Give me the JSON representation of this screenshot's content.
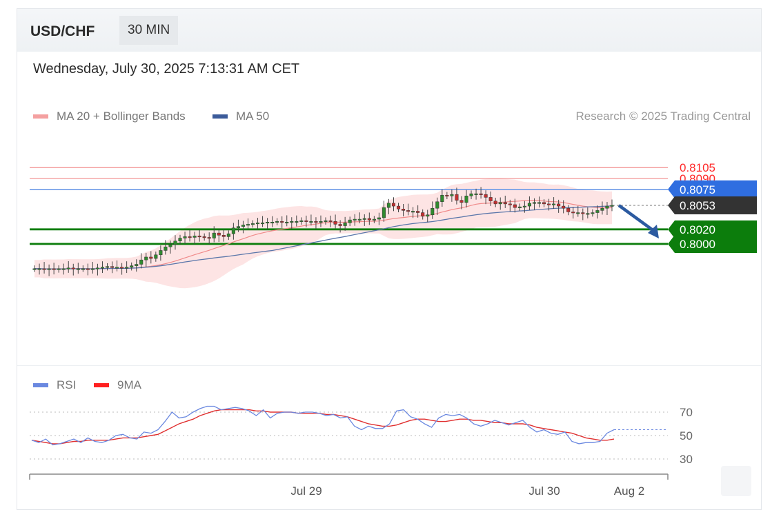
{
  "header": {
    "pair": "USD/CHF",
    "timeframe": "30 MIN"
  },
  "datetime": "Wednesday, July 30, 2025 7:13:31 AM CET",
  "legend": {
    "ma20": {
      "label": "MA 20 + Bollinger Bands",
      "color": "#f08080"
    },
    "ma50": {
      "label": "MA 50",
      "color": "#3b5b9a"
    }
  },
  "credit": "Research © 2025 Trading Central",
  "rsi_legend": {
    "rsi": {
      "label": "RSI",
      "color": "#6a88e0"
    },
    "ma9": {
      "label": "9MA",
      "color": "#ff2020"
    }
  },
  "levels": [
    {
      "label": "0.8105",
      "value": 0.8105,
      "kind": "resistance",
      "color": "#ff2a2a"
    },
    {
      "label": "0.8090",
      "value": 0.809,
      "kind": "resistance",
      "color": "#ff2a2a"
    },
    {
      "label": "0.8075",
      "value": 0.8075,
      "kind": "pivot",
      "color": "#2f6ee0"
    },
    {
      "label": "0.8053",
      "value": 0.8053,
      "kind": "last",
      "color": "#333333"
    },
    {
      "label": "0.8020",
      "value": 0.802,
      "kind": "support",
      "color": "#0c7d0c"
    },
    {
      "label": "0.8000",
      "value": 0.8,
      "kind": "support",
      "color": "#0c7d0c"
    }
  ],
  "rsi_levels": [
    "70",
    "50",
    "30"
  ],
  "x_labels": [
    "Jul 29",
    "Jul 30",
    "Aug 2"
  ],
  "chart_data": [
    {
      "type": "candlestick",
      "title": "USD/CHF 30 MIN",
      "ylim": [
        0.7945,
        0.812
      ],
      "indicators": [
        "MA 20 + Bollinger Bands",
        "MA 50"
      ],
      "expected_move": {
        "from": 0.8053,
        "to": 0.8,
        "direction": "down"
      },
      "closes": [
        0.7966,
        0.7966,
        0.7965,
        0.7966,
        0.7965,
        0.7966,
        0.7966,
        0.7967,
        0.7966,
        0.7966,
        0.7966,
        0.7965,
        0.7966,
        0.7967,
        0.7968,
        0.7969,
        0.7968,
        0.7968,
        0.7967,
        0.7968,
        0.797,
        0.7972,
        0.7978,
        0.7982,
        0.798,
        0.7985,
        0.7991,
        0.7996,
        0.7999,
        0.8004,
        0.8008,
        0.801,
        0.8009,
        0.8011,
        0.801,
        0.8009,
        0.8008,
        0.8015,
        0.8012,
        0.801,
        0.8014,
        0.8022,
        0.8024,
        0.8026,
        0.8027,
        0.8028,
        0.8029,
        0.8029,
        0.803,
        0.803,
        0.8031,
        0.803,
        0.803,
        0.8031,
        0.8031,
        0.8032,
        0.8031,
        0.8031,
        0.803,
        0.8031,
        0.8032,
        0.8031,
        0.8027,
        0.8025,
        0.8029,
        0.8033,
        0.8034,
        0.8034,
        0.8035,
        0.8033,
        0.8034,
        0.8036,
        0.805,
        0.8056,
        0.8052,
        0.8048,
        0.8046,
        0.8045,
        0.8045,
        0.8043,
        0.8038,
        0.804,
        0.8049,
        0.8058,
        0.8067,
        0.8066,
        0.8068,
        0.806,
        0.8057,
        0.8066,
        0.8069,
        0.8069,
        0.8068,
        0.8064,
        0.8059,
        0.8055,
        0.8057,
        0.8055,
        0.8054,
        0.805,
        0.8051,
        0.8052,
        0.8056,
        0.8057,
        0.8057,
        0.8055,
        0.8054,
        0.8055,
        0.8052,
        0.8049,
        0.8044,
        0.8043,
        0.8043,
        0.8042,
        0.8042,
        0.8043,
        0.8046,
        0.8049,
        0.8052,
        0.8053
      ]
    },
    {
      "type": "line",
      "title": "RSI",
      "ylim": [
        20,
        85
      ],
      "series": [
        {
          "name": "RSI",
          "values": [
            46,
            44,
            47,
            42,
            43,
            45,
            47,
            44,
            48,
            45,
            44,
            46,
            50,
            51,
            48,
            47,
            53,
            52,
            55,
            62,
            70,
            65,
            66,
            70,
            73,
            75,
            75,
            72,
            73,
            74,
            73,
            71,
            67,
            72,
            65,
            69,
            70,
            70,
            69,
            70,
            70,
            69,
            67,
            68,
            65,
            66,
            58,
            55,
            58,
            56,
            56,
            60,
            71,
            72,
            66,
            64,
            60,
            57,
            65,
            68,
            67,
            68,
            65,
            60,
            58,
            60,
            63,
            61,
            59,
            61,
            63,
            57,
            53,
            55,
            52,
            51,
            53,
            45,
            43,
            44,
            44,
            45,
            52,
            55
          ]
        },
        {
          "name": "9MA",
          "values": [
            46,
            45,
            44,
            43,
            43,
            44,
            45,
            45,
            46,
            46,
            46,
            46,
            47,
            48,
            48,
            48,
            49,
            50,
            51,
            54,
            57,
            60,
            62,
            64,
            67,
            69,
            71,
            72,
            72,
            72,
            72,
            72,
            71,
            71,
            70,
            70,
            70,
            70,
            69,
            69,
            69,
            69,
            68,
            68,
            67,
            66,
            64,
            62,
            60,
            59,
            58,
            58,
            59,
            61,
            63,
            64,
            64,
            63,
            62,
            62,
            63,
            64,
            64,
            63,
            63,
            62,
            61,
            61,
            60,
            60,
            60,
            59,
            57,
            56,
            55,
            54,
            53,
            52,
            50,
            48,
            47,
            46,
            46,
            47
          ]
        }
      ]
    }
  ]
}
